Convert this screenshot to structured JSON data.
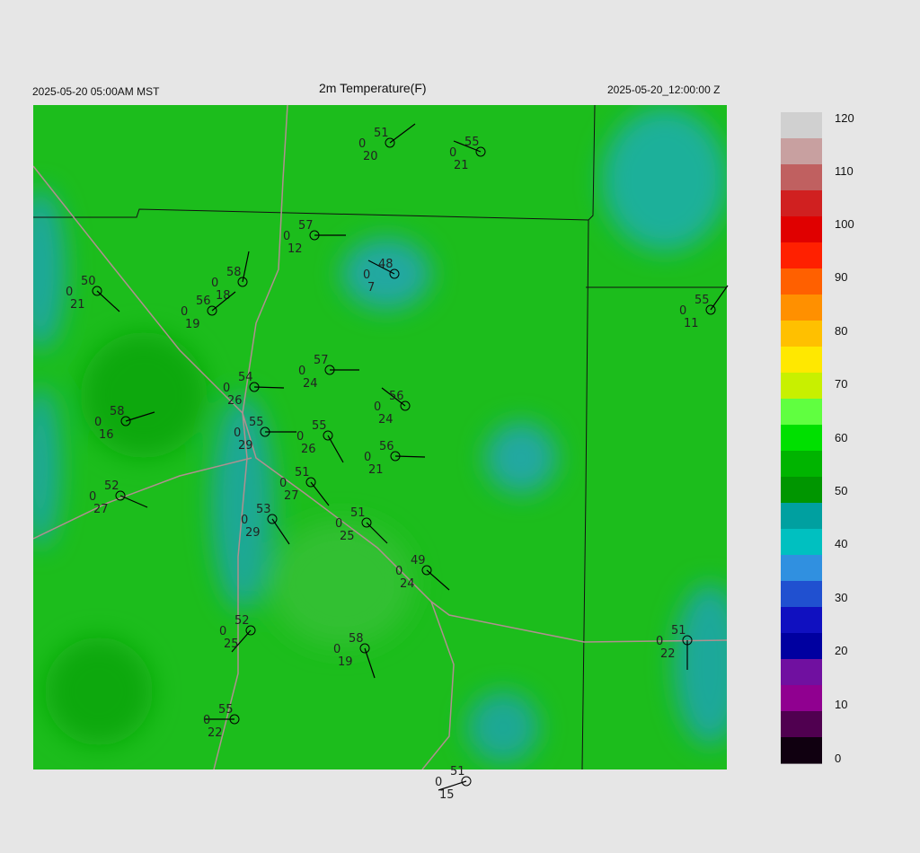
{
  "header": {
    "local_time": "2025-05-20 05:00AM MST",
    "title": "2m Temperature(F)",
    "utc_time": "2025-05-20_12:00:00 Z"
  },
  "colorbar": {
    "ticks": [
      "120",
      "110",
      "100",
      "90",
      "80",
      "70",
      "60",
      "50",
      "40",
      "30",
      "20",
      "10",
      "0"
    ],
    "colors": [
      "#d0d0d0",
      "#c8a0a0",
      "#c06060",
      "#d02020",
      "#e00000",
      "#ff2000",
      "#ff6000",
      "#ff9000",
      "#ffc000",
      "#ffe800",
      "#c8f000",
      "#60ff40",
      "#00e000",
      "#00b400",
      "#009600",
      "#00a0a0",
      "#00c0c0",
      "#3090e0",
      "#2050d0",
      "#1010c0",
      "#0000a0",
      "#7010a0",
      "#900090",
      "#500050",
      "#100010"
    ]
  },
  "stations": [
    {
      "t": "51",
      "d": "20"
    },
    {
      "t": "55",
      "d": "21"
    },
    {
      "t": "57",
      "d": "12"
    },
    {
      "t": "48",
      "d": "7"
    },
    {
      "t": "58",
      "d": "18"
    },
    {
      "t": "50",
      "d": "21"
    },
    {
      "t": "56",
      "d": "19"
    },
    {
      "t": "55",
      "d": "11"
    },
    {
      "t": "57",
      "d": "24"
    },
    {
      "t": "54",
      "d": "26"
    },
    {
      "t": "56",
      "d": "24"
    },
    {
      "t": "58",
      "d": "16"
    },
    {
      "t": "55",
      "d": "29"
    },
    {
      "t": "55",
      "d": "26"
    },
    {
      "t": "56",
      "d": "21"
    },
    {
      "t": "51",
      "d": "27"
    },
    {
      "t": "52",
      "d": "27"
    },
    {
      "t": "53",
      "d": "29"
    },
    {
      "t": "51",
      "d": "25"
    },
    {
      "t": "49",
      "d": "24"
    },
    {
      "t": "52",
      "d": "25"
    },
    {
      "t": "58",
      "d": "19"
    },
    {
      "t": "51",
      "d": "22"
    },
    {
      "t": "55",
      "d": "22"
    },
    {
      "t": "51",
      "d": "15"
    }
  ]
}
